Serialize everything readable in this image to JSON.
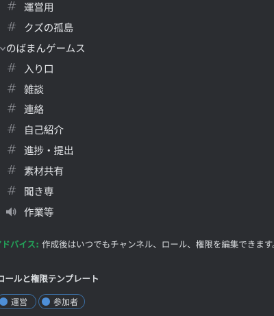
{
  "channels": [
    {
      "type": "text",
      "icon": "hash-icon",
      "label": "運営用"
    },
    {
      "type": "text",
      "icon": "hash-icon",
      "label": "クズの孤島"
    },
    {
      "type": "category",
      "icon": "chevron-down-icon",
      "label": "のばまんゲームス"
    },
    {
      "type": "text",
      "icon": "hash-icon",
      "label": "入り口"
    },
    {
      "type": "text",
      "icon": "hash-icon",
      "label": "雑談"
    },
    {
      "type": "text",
      "icon": "hash-icon",
      "label": "連絡"
    },
    {
      "type": "text",
      "icon": "hash-icon",
      "label": "自己紹介"
    },
    {
      "type": "text",
      "icon": "hash-icon",
      "label": "進捗・提出"
    },
    {
      "type": "text",
      "icon": "hash-icon",
      "label": "素材共有"
    },
    {
      "type": "text",
      "icon": "hash-icon",
      "label": "聞き専"
    },
    {
      "type": "voice",
      "icon": "speaker-icon",
      "label": "作業等"
    }
  ],
  "advice": {
    "tag": "アドバイス:",
    "text": "作成後はいつでもチャンネル、ロール、権限を編集できます。"
  },
  "templates": {
    "title": "ロールと権限テンプレート",
    "chips": [
      {
        "label": "運営"
      },
      {
        "label": "参加者"
      }
    ]
  },
  "colors": {
    "background": "#2b2d31",
    "text": "#dbdee1",
    "muted_icon": "#9a9ca2",
    "advice_tag": "#23a55a",
    "chip_border": "#3b6fa4",
    "chip_dot": "#4e8fd8"
  }
}
